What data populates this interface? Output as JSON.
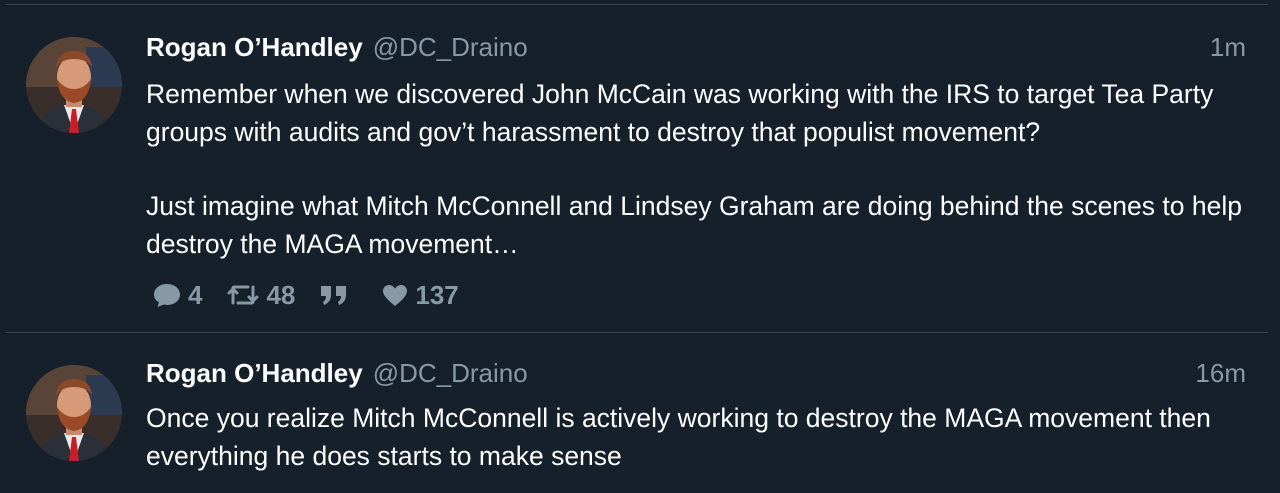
{
  "tweets": [
    {
      "author_name": "Rogan O’Handley",
      "handle": "@DC_Draino",
      "time": "1m",
      "text_lines_1": "Remember when we discovered John McCain was working with the IRS to target Tea Party groups with audits and gov’t harassment to destroy that populist movement?",
      "text_lines_2": "Just imagine what Mitch McConnell and Lindsey Graham are doing behind the scenes to help destroy the MAGA movement…",
      "replies": "4",
      "retweets": "48",
      "likes": "137"
    },
    {
      "author_name": "Rogan O’Handley",
      "handle": "@DC_Draino",
      "time": "16m",
      "text": "Once you realize Mitch McConnell is actively working to destroy the MAGA movement then everything he does starts to make sense"
    }
  ],
  "colors": {
    "background": "#15202b",
    "divider": "#38444d",
    "secondary_text": "#8899a6",
    "primary_text": "#ffffff"
  },
  "icons": {
    "reply": "speech-bubble-icon",
    "retweet": "retweet-arrows-icon",
    "quote": "quote-marks-icon",
    "like": "heart-icon"
  }
}
